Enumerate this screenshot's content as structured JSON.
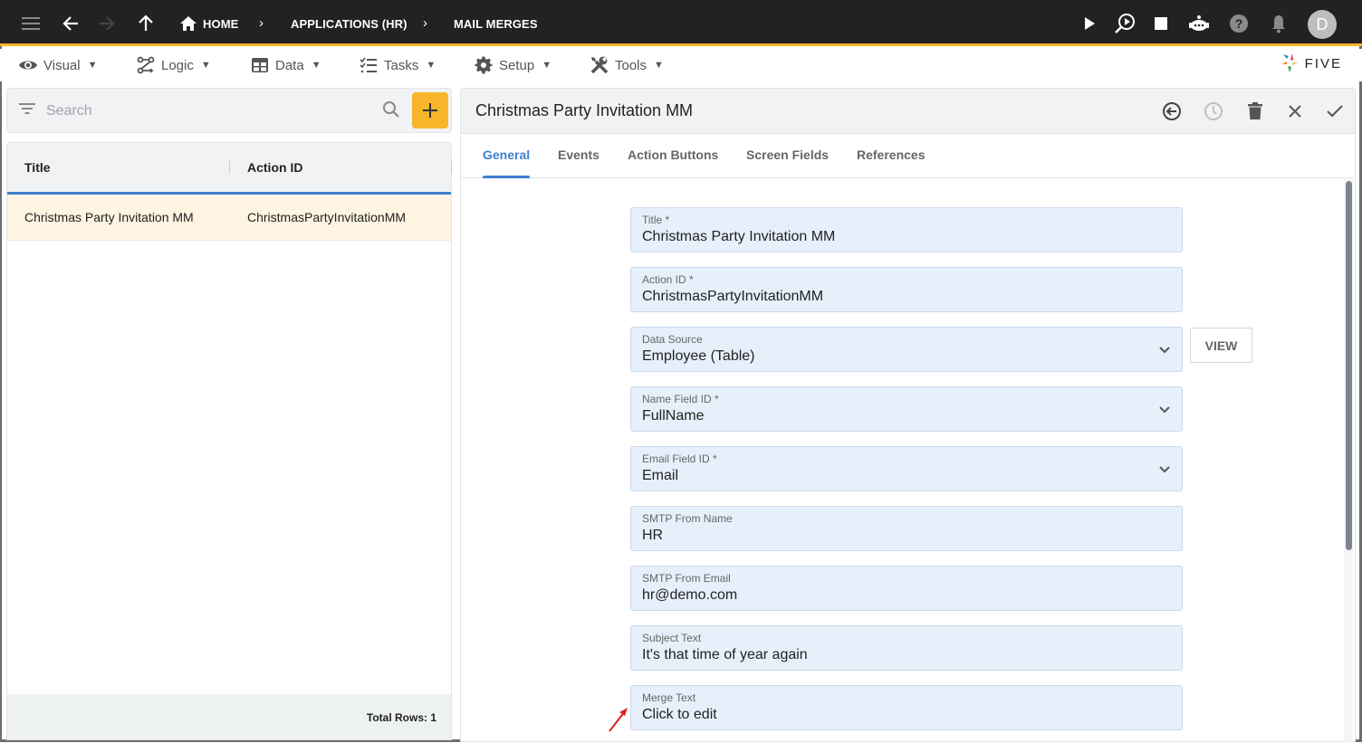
{
  "topbar": {
    "breadcrumbs": [
      {
        "label": "HOME",
        "icon": "home-icon"
      },
      {
        "label": "APPLICATIONS (HR)"
      },
      {
        "label": "MAIL MERGES"
      }
    ],
    "avatar_initial": "D",
    "icons": [
      "menu-icon",
      "back-arrow-icon",
      "forward-arrow-icon",
      "up-arrow-icon",
      "play-icon",
      "search-play-icon",
      "stop-icon",
      "chat-bot-icon",
      "help-icon",
      "bell-icon"
    ]
  },
  "menubar": {
    "items": [
      {
        "label": "Visual",
        "icon": "eye-icon"
      },
      {
        "label": "Logic",
        "icon": "logic-icon"
      },
      {
        "label": "Data",
        "icon": "table-icon"
      },
      {
        "label": "Tasks",
        "icon": "checklist-icon"
      },
      {
        "label": "Setup",
        "icon": "gear-icon"
      },
      {
        "label": "Tools",
        "icon": "tools-icon"
      }
    ],
    "caret": "▼",
    "logo_text": "FIVE"
  },
  "list_panel": {
    "search_placeholder": "Search",
    "add_label": "+",
    "columns": [
      "Title",
      "Action ID"
    ],
    "rows": [
      {
        "title": "Christmas Party Invitation MM",
        "action_id": "ChristmasPartyInvitationMM"
      }
    ],
    "footer": "Total Rows: 1"
  },
  "detail": {
    "title": "Christmas Party Invitation MM",
    "tabs": [
      "General",
      "Events",
      "Action Buttons",
      "Screen Fields",
      "References"
    ],
    "active_tab": "General",
    "view_button": "VIEW",
    "fields": [
      {
        "label": "Title *",
        "value": "Christmas Party Invitation MM",
        "type": "text"
      },
      {
        "label": "Action ID *",
        "value": "ChristmasPartyInvitationMM",
        "type": "text"
      },
      {
        "label": "Data Source",
        "value": "Employee (Table)",
        "type": "select"
      },
      {
        "label": "Name Field ID *",
        "value": "FullName",
        "type": "select"
      },
      {
        "label": "Email Field ID *",
        "value": "Email",
        "type": "select"
      },
      {
        "label": "SMTP From Name",
        "value": "HR",
        "type": "text"
      },
      {
        "label": "SMTP From Email",
        "value": "hr@demo.com",
        "type": "text"
      },
      {
        "label": "Subject Text",
        "value": "It's that time of year again",
        "type": "text"
      },
      {
        "label": "Merge Text",
        "value": "Click to edit",
        "type": "text"
      }
    ]
  },
  "colors": {
    "topbar_bg": "#222222",
    "accent_yellow": "#f6b52a",
    "accent_blue": "#3f7fd0",
    "field_bg": "#e6f0fb",
    "selected_row": "#fef4e1",
    "annotation_arrow": "#e02020"
  }
}
